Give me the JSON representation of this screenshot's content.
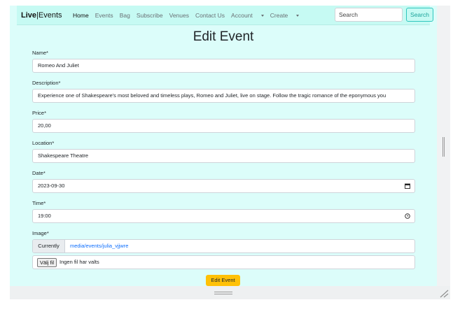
{
  "brand": {
    "bold": "Live",
    "separator": "|",
    "rest": "Events"
  },
  "nav": {
    "home": "Home",
    "events": "Events",
    "bag": "Bag",
    "subscribe": "Subscribe",
    "venues": "Venues",
    "contact": "Contact Us",
    "account": "Account",
    "create": "Create"
  },
  "search": {
    "placeholder": "Search",
    "button": "Search"
  },
  "page_title": "Edit Event",
  "form": {
    "name_label": "Name*",
    "name_value": "Romeo And Juliet",
    "description_label": "Description*",
    "description_value": "Experience one of Shakespeare's most beloved and timeless plays, Romeo and Juliet, live on stage. Follow the tragic romance of the eponymous you",
    "price_label": "Price*",
    "price_value": "20,00",
    "location_label": "Location*",
    "location_value": "Shakespeare Theatre",
    "date_label": "Date*",
    "date_value": "2023-09-30",
    "time_label": "Time*",
    "time_value": "19:00",
    "image_label": "Image*",
    "currently_label": "Currently",
    "currently_link": "media/events/julia_vjjwre",
    "file_button": "Välj fil",
    "file_status": "Ingen fil har valts",
    "submit": "Edit Event"
  },
  "colors": {
    "page_bg": "#dcfdfa",
    "navbar_bg": "#c6faf3",
    "accent": "#2ec6bd",
    "submit_bg": "#ffc107",
    "link": "#0d6efd"
  }
}
